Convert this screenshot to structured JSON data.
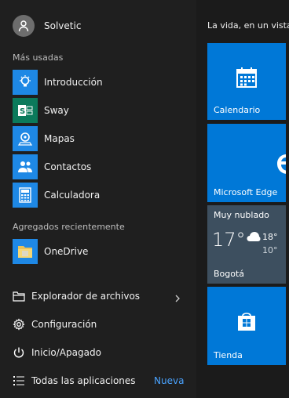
{
  "user": {
    "name": "Solvetic"
  },
  "sections": {
    "most_used": "Más usadas",
    "recently_added": "Agregados recientemente"
  },
  "most_used_apps": [
    {
      "label": "Introducción",
      "icon": "lightbulb-icon",
      "color": "#1e88e5"
    },
    {
      "label": "Sway",
      "icon": "sway-icon",
      "color": "#0b7a5b"
    },
    {
      "label": "Mapas",
      "icon": "maps-icon",
      "color": "#1e88e5"
    },
    {
      "label": "Contactos",
      "icon": "contacts-icon",
      "color": "#1e88e5"
    },
    {
      "label": "Calculadora",
      "icon": "calculator-icon",
      "color": "#1e88e5"
    }
  ],
  "recent_apps": [
    {
      "label": "OneDrive",
      "icon": "onedrive-folder-icon",
      "color": "#1e88e5"
    }
  ],
  "system_items": {
    "file_explorer": "Explorador de archivos",
    "settings": "Configuración",
    "power": "Inicio/Apagado",
    "all_apps": "Todas las aplicaciones",
    "new_badge": "Nueva"
  },
  "tiles": {
    "group_title": "La vida, en un vistaz",
    "calendar": "Calendario",
    "edge": "Microsoft Edge",
    "weather": {
      "condition": "Muy nublado",
      "temp": "17°",
      "high": "18°",
      "low": "10°",
      "city": "Bogotá"
    },
    "store": "Tienda"
  },
  "colors": {
    "accent": "#0078d7",
    "background": "#1f1f1f",
    "weather_tile": "#3d4f5f",
    "new_badge": "#4aa3ff"
  }
}
